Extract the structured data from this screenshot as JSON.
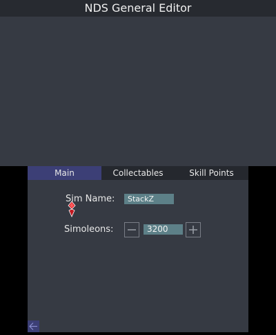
{
  "top_screen": {
    "title": "NDS General Editor"
  },
  "tabs": [
    {
      "label": "Main",
      "active": true
    },
    {
      "label": "Collectables",
      "active": false
    },
    {
      "label": "Skill Points",
      "active": false
    }
  ],
  "main": {
    "sim_name_label": "Sim Name:",
    "sim_name_value": "StackZ",
    "simoleons_label": "Simoleons:",
    "simoleons_value": "3200"
  },
  "icons": {
    "minus": "minus-icon",
    "plus": "plus-icon",
    "back": "back-arrow-icon",
    "cursor": "pointer-cursor-icon"
  },
  "colors": {
    "background": "#363a43",
    "title_bar": "#272a30",
    "active_tab": "#3c3f76",
    "input_bg": "#5d8088",
    "cursor_red": "#d8202a"
  }
}
